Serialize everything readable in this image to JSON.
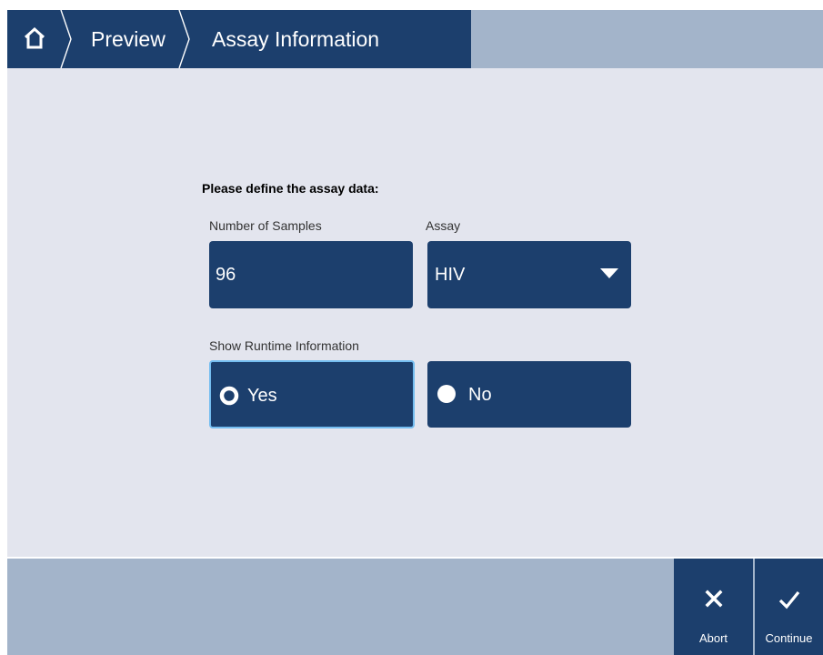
{
  "breadcrumb": {
    "home_icon": "home-icon",
    "items": [
      {
        "label": "Preview"
      },
      {
        "label": "Assay Information"
      }
    ]
  },
  "form": {
    "heading": "Please define the assay data:",
    "samples": {
      "label": "Number of Samples",
      "value": "96"
    },
    "assay": {
      "label": "Assay",
      "value": "HIV",
      "icon": "dropdown-caret-icon"
    },
    "runtime": {
      "label": "Show Runtime Information",
      "options": [
        {
          "label": "Yes",
          "selected": true
        },
        {
          "label": "No",
          "selected": false
        }
      ]
    }
  },
  "actions": {
    "abort": {
      "label": "Abort",
      "icon": "close-icon"
    },
    "continue": {
      "label": "Continue",
      "icon": "checkmark-icon"
    }
  },
  "colors": {
    "primary": "#1c3f6d",
    "bar": "#a3b4ca",
    "background": "#e3e5ee",
    "focus": "#74bdf0"
  }
}
